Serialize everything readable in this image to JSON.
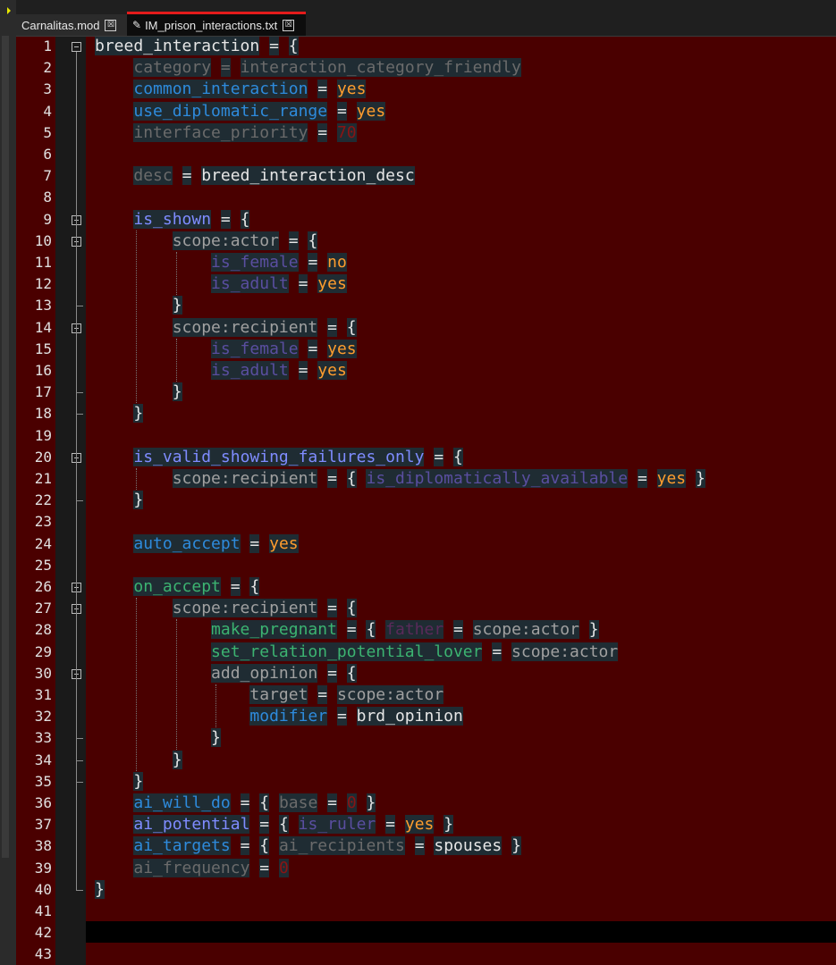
{
  "tabs": [
    {
      "label": "Carnalitas.mod",
      "close": "☒"
    },
    {
      "label": "IM_prison_interactions.txt",
      "close": "☒",
      "active": true,
      "modified_icon": "pencil-icon"
    }
  ],
  "colors": {
    "background": "#4a0000",
    "token_bg": "#1f2c33",
    "keyword_blue": "#5fb3ff",
    "keyword_gray": "#6b6b6b",
    "value_orange": "#ff9d2e",
    "purple": "#5a4ea0",
    "green": "#3cb371",
    "number_red": "#8a1414",
    "white": "#e6e6e6",
    "scope_gray": "#a0a0a0",
    "tab_accent": "#e41b1b"
  },
  "line_numbers": [
    "1",
    "2",
    "3",
    "4",
    "5",
    "6",
    "7",
    "8",
    "9",
    "10",
    "11",
    "12",
    "13",
    "14",
    "15",
    "16",
    "17",
    "18",
    "19",
    "20",
    "21",
    "22",
    "23",
    "24",
    "25",
    "26",
    "27",
    "28",
    "29",
    "30",
    "31",
    "32",
    "33",
    "34",
    "35",
    "36",
    "37",
    "38",
    "39",
    "40",
    "41",
    "42",
    "43"
  ],
  "code": [
    [
      {
        "t": "breed_interaction",
        "c": "#e6e6e6"
      },
      {
        "t": " "
      },
      {
        "t": "=",
        "c": "#e6e6e6"
      },
      {
        "t": " "
      },
      {
        "t": "{",
        "c": "#e6e6e6"
      }
    ],
    [
      {
        "t": "    "
      },
      {
        "t": "category",
        "c": "#6b6b6b"
      },
      {
        "t": " "
      },
      {
        "t": "=",
        "c": "#6b6b6b"
      },
      {
        "t": " "
      },
      {
        "t": "interaction_category_friendly",
        "c": "#6b6b6b"
      }
    ],
    [
      {
        "t": "    "
      },
      {
        "t": "common_interaction",
        "c": "#2e8bdc"
      },
      {
        "t": " "
      },
      {
        "t": "=",
        "c": "#e6e6e6"
      },
      {
        "t": " "
      },
      {
        "t": "yes",
        "c": "#ff9d2e"
      }
    ],
    [
      {
        "t": "    "
      },
      {
        "t": "use_diplomatic_range",
        "c": "#2e8bdc"
      },
      {
        "t": " "
      },
      {
        "t": "=",
        "c": "#e6e6e6"
      },
      {
        "t": " "
      },
      {
        "t": "yes",
        "c": "#ff9d2e"
      }
    ],
    [
      {
        "t": "    "
      },
      {
        "t": "interface_priority",
        "c": "#6b6b6b"
      },
      {
        "t": " "
      },
      {
        "t": "=",
        "c": "#e6e6e6"
      },
      {
        "t": " "
      },
      {
        "t": "70",
        "c": "#8a1414"
      }
    ],
    [],
    [
      {
        "t": "    "
      },
      {
        "t": "desc",
        "c": "#6b6b6b"
      },
      {
        "t": " "
      },
      {
        "t": "=",
        "c": "#e6e6e6"
      },
      {
        "t": " "
      },
      {
        "t": "breed_interaction_desc",
        "c": "#e6e6e6"
      }
    ],
    [],
    [
      {
        "t": "    "
      },
      {
        "t": "is_shown",
        "c": "#7f8cff"
      },
      {
        "t": " "
      },
      {
        "t": "=",
        "c": "#e6e6e6"
      },
      {
        "t": " "
      },
      {
        "t": "{",
        "c": "#e6e6e6"
      }
    ],
    [
      {
        "t": "        "
      },
      {
        "t": "scope:actor",
        "c": "#a0a0a0"
      },
      {
        "t": " "
      },
      {
        "t": "=",
        "c": "#e6e6e6"
      },
      {
        "t": " "
      },
      {
        "t": "{",
        "c": "#e6e6e6"
      }
    ],
    [
      {
        "t": "            "
      },
      {
        "t": "is_female",
        "c": "#5a4ea0"
      },
      {
        "t": " "
      },
      {
        "t": "=",
        "c": "#e6e6e6"
      },
      {
        "t": " "
      },
      {
        "t": "no",
        "c": "#ff9d2e"
      }
    ],
    [
      {
        "t": "            "
      },
      {
        "t": "is_adult",
        "c": "#5a4ea0"
      },
      {
        "t": " "
      },
      {
        "t": "=",
        "c": "#e6e6e6"
      },
      {
        "t": " "
      },
      {
        "t": "yes",
        "c": "#ff9d2e"
      }
    ],
    [
      {
        "t": "        "
      },
      {
        "t": "}",
        "c": "#e6e6e6"
      }
    ],
    [
      {
        "t": "        "
      },
      {
        "t": "scope:recipient",
        "c": "#a0a0a0"
      },
      {
        "t": " "
      },
      {
        "t": "=",
        "c": "#e6e6e6"
      },
      {
        "t": " "
      },
      {
        "t": "{",
        "c": "#e6e6e6"
      }
    ],
    [
      {
        "t": "            "
      },
      {
        "t": "is_female",
        "c": "#5a4ea0"
      },
      {
        "t": " "
      },
      {
        "t": "=",
        "c": "#e6e6e6"
      },
      {
        "t": " "
      },
      {
        "t": "yes",
        "c": "#ff9d2e"
      }
    ],
    [
      {
        "t": "            "
      },
      {
        "t": "is_adult",
        "c": "#5a4ea0"
      },
      {
        "t": " "
      },
      {
        "t": "=",
        "c": "#e6e6e6"
      },
      {
        "t": " "
      },
      {
        "t": "yes",
        "c": "#ff9d2e"
      }
    ],
    [
      {
        "t": "        "
      },
      {
        "t": "}",
        "c": "#e6e6e6"
      }
    ],
    [
      {
        "t": "    "
      },
      {
        "t": "}",
        "c": "#e6e6e6"
      }
    ],
    [],
    [
      {
        "t": "    "
      },
      {
        "t": "is_valid_showing_failures_only",
        "c": "#7f8cff"
      },
      {
        "t": " "
      },
      {
        "t": "=",
        "c": "#e6e6e6"
      },
      {
        "t": " "
      },
      {
        "t": "{",
        "c": "#e6e6e6"
      }
    ],
    [
      {
        "t": "        "
      },
      {
        "t": "scope:recipient",
        "c": "#a0a0a0"
      },
      {
        "t": " "
      },
      {
        "t": "=",
        "c": "#e6e6e6"
      },
      {
        "t": " "
      },
      {
        "t": "{",
        "c": "#e6e6e6"
      },
      {
        "t": " "
      },
      {
        "t": "is_diplomatically_available",
        "c": "#5a4ea0"
      },
      {
        "t": " "
      },
      {
        "t": "=",
        "c": "#e6e6e6"
      },
      {
        "t": " "
      },
      {
        "t": "yes",
        "c": "#ff9d2e"
      },
      {
        "t": " "
      },
      {
        "t": "}",
        "c": "#e6e6e6"
      }
    ],
    [
      {
        "t": "    "
      },
      {
        "t": "}",
        "c": "#e6e6e6"
      }
    ],
    [],
    [
      {
        "t": "    "
      },
      {
        "t": "auto_accept",
        "c": "#2e8bdc"
      },
      {
        "t": " "
      },
      {
        "t": "=",
        "c": "#e6e6e6"
      },
      {
        "t": " "
      },
      {
        "t": "yes",
        "c": "#ff9d2e"
      }
    ],
    [],
    [
      {
        "t": "    "
      },
      {
        "t": "on_accept",
        "c": "#3cb371"
      },
      {
        "t": " "
      },
      {
        "t": "=",
        "c": "#e6e6e6"
      },
      {
        "t": " "
      },
      {
        "t": "{",
        "c": "#e6e6e6"
      }
    ],
    [
      {
        "t": "        "
      },
      {
        "t": "scope:recipient",
        "c": "#a0a0a0"
      },
      {
        "t": " "
      },
      {
        "t": "=",
        "c": "#e6e6e6"
      },
      {
        "t": " "
      },
      {
        "t": "{",
        "c": "#e6e6e6"
      }
    ],
    [
      {
        "t": "            "
      },
      {
        "t": "make_pregnant",
        "c": "#3cb371"
      },
      {
        "t": " "
      },
      {
        "t": "=",
        "c": "#e6e6e6"
      },
      {
        "t": " "
      },
      {
        "t": "{",
        "c": "#e6e6e6"
      },
      {
        "t": " "
      },
      {
        "t": "father",
        "c": "#5a2a5a"
      },
      {
        "t": " "
      },
      {
        "t": "=",
        "c": "#e6e6e6"
      },
      {
        "t": " "
      },
      {
        "t": "scope:actor",
        "c": "#a0a0a0"
      },
      {
        "t": " "
      },
      {
        "t": "}",
        "c": "#e6e6e6"
      }
    ],
    [
      {
        "t": "            "
      },
      {
        "t": "set_relation_potential_lover",
        "c": "#3cb371"
      },
      {
        "t": " "
      },
      {
        "t": "=",
        "c": "#e6e6e6"
      },
      {
        "t": " "
      },
      {
        "t": "scope:actor",
        "c": "#a0a0a0"
      }
    ],
    [
      {
        "t": "            "
      },
      {
        "t": "add_opinion",
        "c": "#a0a0a0"
      },
      {
        "t": " "
      },
      {
        "t": "=",
        "c": "#e6e6e6"
      },
      {
        "t": " "
      },
      {
        "t": "{",
        "c": "#e6e6e6"
      }
    ],
    [
      {
        "t": "                "
      },
      {
        "t": "target",
        "c": "#a0a0a0"
      },
      {
        "t": " "
      },
      {
        "t": "=",
        "c": "#e6e6e6"
      },
      {
        "t": " "
      },
      {
        "t": "scope:actor",
        "c": "#a0a0a0"
      }
    ],
    [
      {
        "t": "                "
      },
      {
        "t": "modifier",
        "c": "#2e8bdc"
      },
      {
        "t": " "
      },
      {
        "t": "=",
        "c": "#e6e6e6"
      },
      {
        "t": " "
      },
      {
        "t": "brd_opinion",
        "c": "#e6e6e6"
      }
    ],
    [
      {
        "t": "            "
      },
      {
        "t": "}",
        "c": "#e6e6e6"
      }
    ],
    [
      {
        "t": "        "
      },
      {
        "t": "}",
        "c": "#e6e6e6"
      }
    ],
    [
      {
        "t": "    "
      },
      {
        "t": "}",
        "c": "#e6e6e6"
      }
    ],
    [
      {
        "t": "    "
      },
      {
        "t": "ai_will_do",
        "c": "#2e8bdc"
      },
      {
        "t": " "
      },
      {
        "t": "=",
        "c": "#e6e6e6"
      },
      {
        "t": " "
      },
      {
        "t": "{",
        "c": "#e6e6e6"
      },
      {
        "t": " "
      },
      {
        "t": "base",
        "c": "#6b6b6b"
      },
      {
        "t": " "
      },
      {
        "t": "=",
        "c": "#e6e6e6"
      },
      {
        "t": " "
      },
      {
        "t": "0",
        "c": "#8a1414"
      },
      {
        "t": " "
      },
      {
        "t": "}",
        "c": "#e6e6e6"
      }
    ],
    [
      {
        "t": "    "
      },
      {
        "t": "ai_potential",
        "c": "#7f8cff"
      },
      {
        "t": " "
      },
      {
        "t": "=",
        "c": "#e6e6e6"
      },
      {
        "t": " "
      },
      {
        "t": "{",
        "c": "#e6e6e6"
      },
      {
        "t": " "
      },
      {
        "t": "is_ruler",
        "c": "#5a4ea0"
      },
      {
        "t": " "
      },
      {
        "t": "=",
        "c": "#e6e6e6"
      },
      {
        "t": " "
      },
      {
        "t": "yes",
        "c": "#ff9d2e"
      },
      {
        "t": " "
      },
      {
        "t": "}",
        "c": "#e6e6e6"
      }
    ],
    [
      {
        "t": "    "
      },
      {
        "t": "ai_targets",
        "c": "#2e8bdc"
      },
      {
        "t": " "
      },
      {
        "t": "=",
        "c": "#e6e6e6"
      },
      {
        "t": " "
      },
      {
        "t": "{",
        "c": "#e6e6e6"
      },
      {
        "t": " "
      },
      {
        "t": "ai_recipients",
        "c": "#6b6b6b"
      },
      {
        "t": " "
      },
      {
        "t": "=",
        "c": "#e6e6e6"
      },
      {
        "t": " "
      },
      {
        "t": "spouses",
        "c": "#e6e6e6"
      },
      {
        "t": " "
      },
      {
        "t": "}",
        "c": "#e6e6e6"
      }
    ],
    [
      {
        "t": "    "
      },
      {
        "t": "ai_frequency",
        "c": "#6b6b6b"
      },
      {
        "t": " "
      },
      {
        "t": "=",
        "c": "#e6e6e6"
      },
      {
        "t": " "
      },
      {
        "t": "0",
        "c": "#8a1414"
      }
    ],
    [
      {
        "t": "}",
        "c": "#e6e6e6"
      }
    ],
    [],
    [],
    []
  ]
}
